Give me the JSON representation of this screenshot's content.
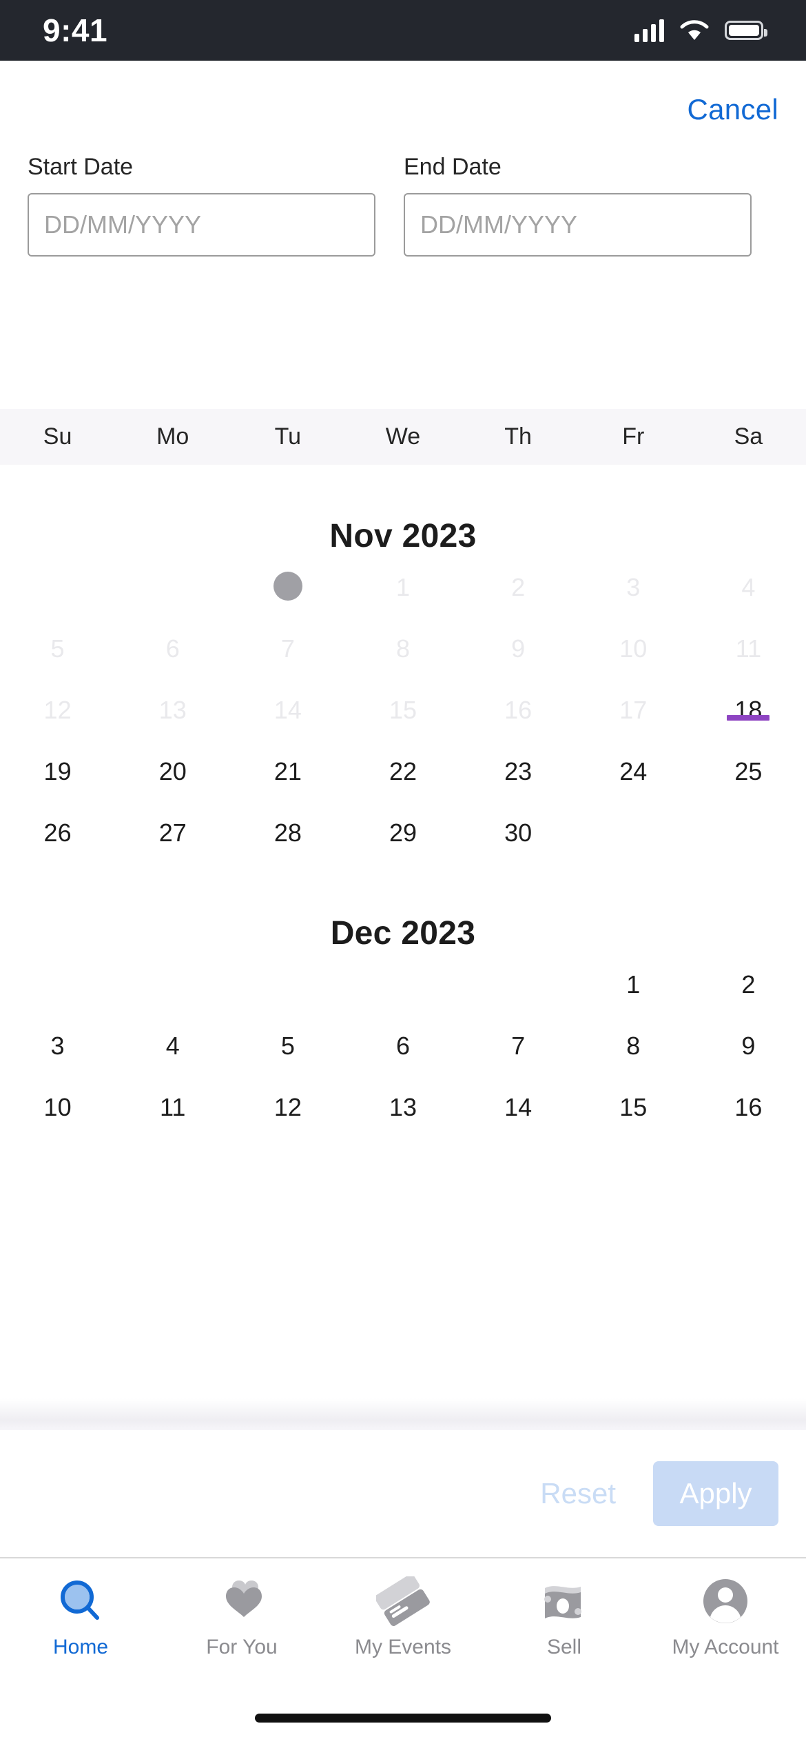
{
  "status_bar": {
    "time": "9:41",
    "signal_icon": "cellular-signal-icon",
    "wifi_icon": "wifi-icon",
    "battery_icon": "battery-icon"
  },
  "header": {
    "cancel_label": "Cancel"
  },
  "date_fields": {
    "start": {
      "label": "Start Date",
      "value": "",
      "placeholder": "DD/MM/YYYY"
    },
    "end": {
      "label": "End Date",
      "value": "",
      "placeholder": "DD/MM/YYYY"
    }
  },
  "weekdays": [
    "Su",
    "Mo",
    "Tu",
    "We",
    "Th",
    "Fr",
    "Sa"
  ],
  "colors": {
    "accent_blue": "#1169d4",
    "today_underline_purple": "#8e44c2",
    "apply_disabled_bg": "#c8daf5",
    "reset_disabled_text": "#c9dcf5",
    "weekday_bar_bg": "#f7f6f9",
    "disabled_day_text": "#e9e9ec",
    "placeholder_dot": "#a0a0a5",
    "status_bar_bg": "#24272e"
  },
  "months": [
    {
      "title": "Nov 2023",
      "weeks": [
        [
          {
            "label": "",
            "state": "empty"
          },
          {
            "label": "",
            "state": "empty"
          },
          {
            "label": "",
            "state": "placeholder"
          },
          {
            "label": "1",
            "state": "disabled"
          },
          {
            "label": "2",
            "state": "disabled"
          },
          {
            "label": "3",
            "state": "disabled"
          },
          {
            "label": "4",
            "state": "disabled"
          }
        ],
        [
          {
            "label": "5",
            "state": "disabled"
          },
          {
            "label": "6",
            "state": "disabled"
          },
          {
            "label": "7",
            "state": "disabled"
          },
          {
            "label": "8",
            "state": "disabled"
          },
          {
            "label": "9",
            "state": "disabled"
          },
          {
            "label": "10",
            "state": "disabled"
          },
          {
            "label": "11",
            "state": "disabled"
          }
        ],
        [
          {
            "label": "12",
            "state": "disabled"
          },
          {
            "label": "13",
            "state": "disabled"
          },
          {
            "label": "14",
            "state": "disabled"
          },
          {
            "label": "15",
            "state": "disabled"
          },
          {
            "label": "16",
            "state": "disabled"
          },
          {
            "label": "17",
            "state": "disabled"
          },
          {
            "label": "18",
            "state": "today"
          }
        ],
        [
          {
            "label": "19",
            "state": "enabled"
          },
          {
            "label": "20",
            "state": "enabled"
          },
          {
            "label": "21",
            "state": "enabled"
          },
          {
            "label": "22",
            "state": "enabled"
          },
          {
            "label": "23",
            "state": "enabled"
          },
          {
            "label": "24",
            "state": "enabled"
          },
          {
            "label": "25",
            "state": "enabled"
          }
        ],
        [
          {
            "label": "26",
            "state": "enabled"
          },
          {
            "label": "27",
            "state": "enabled"
          },
          {
            "label": "28",
            "state": "enabled"
          },
          {
            "label": "29",
            "state": "enabled"
          },
          {
            "label": "30",
            "state": "enabled"
          },
          {
            "label": "",
            "state": "empty"
          },
          {
            "label": "",
            "state": "empty"
          }
        ]
      ]
    },
    {
      "title": "Dec 2023",
      "weeks": [
        [
          {
            "label": "",
            "state": "empty"
          },
          {
            "label": "",
            "state": "empty"
          },
          {
            "label": "",
            "state": "empty"
          },
          {
            "label": "",
            "state": "empty"
          },
          {
            "label": "",
            "state": "empty"
          },
          {
            "label": "1",
            "state": "enabled"
          },
          {
            "label": "2",
            "state": "enabled"
          }
        ],
        [
          {
            "label": "3",
            "state": "enabled"
          },
          {
            "label": "4",
            "state": "enabled"
          },
          {
            "label": "5",
            "state": "enabled"
          },
          {
            "label": "6",
            "state": "enabled"
          },
          {
            "label": "7",
            "state": "enabled"
          },
          {
            "label": "8",
            "state": "enabled"
          },
          {
            "label": "9",
            "state": "enabled"
          }
        ],
        [
          {
            "label": "10",
            "state": "enabled"
          },
          {
            "label": "11",
            "state": "enabled"
          },
          {
            "label": "12",
            "state": "enabled"
          },
          {
            "label": "13",
            "state": "enabled"
          },
          {
            "label": "14",
            "state": "enabled"
          },
          {
            "label": "15",
            "state": "enabled"
          },
          {
            "label": "16",
            "state": "enabled"
          }
        ]
      ]
    }
  ],
  "actions": {
    "reset_label": "Reset",
    "apply_label": "Apply"
  },
  "tabbar": {
    "items": [
      {
        "label": "Home",
        "icon": "search-icon",
        "active": true
      },
      {
        "label": "For You",
        "icon": "hearts-icon",
        "active": false
      },
      {
        "label": "My Events",
        "icon": "tickets-icon",
        "active": false
      },
      {
        "label": "Sell",
        "icon": "money-icon",
        "active": false
      },
      {
        "label": "My Account",
        "icon": "person-icon",
        "active": false
      }
    ]
  }
}
